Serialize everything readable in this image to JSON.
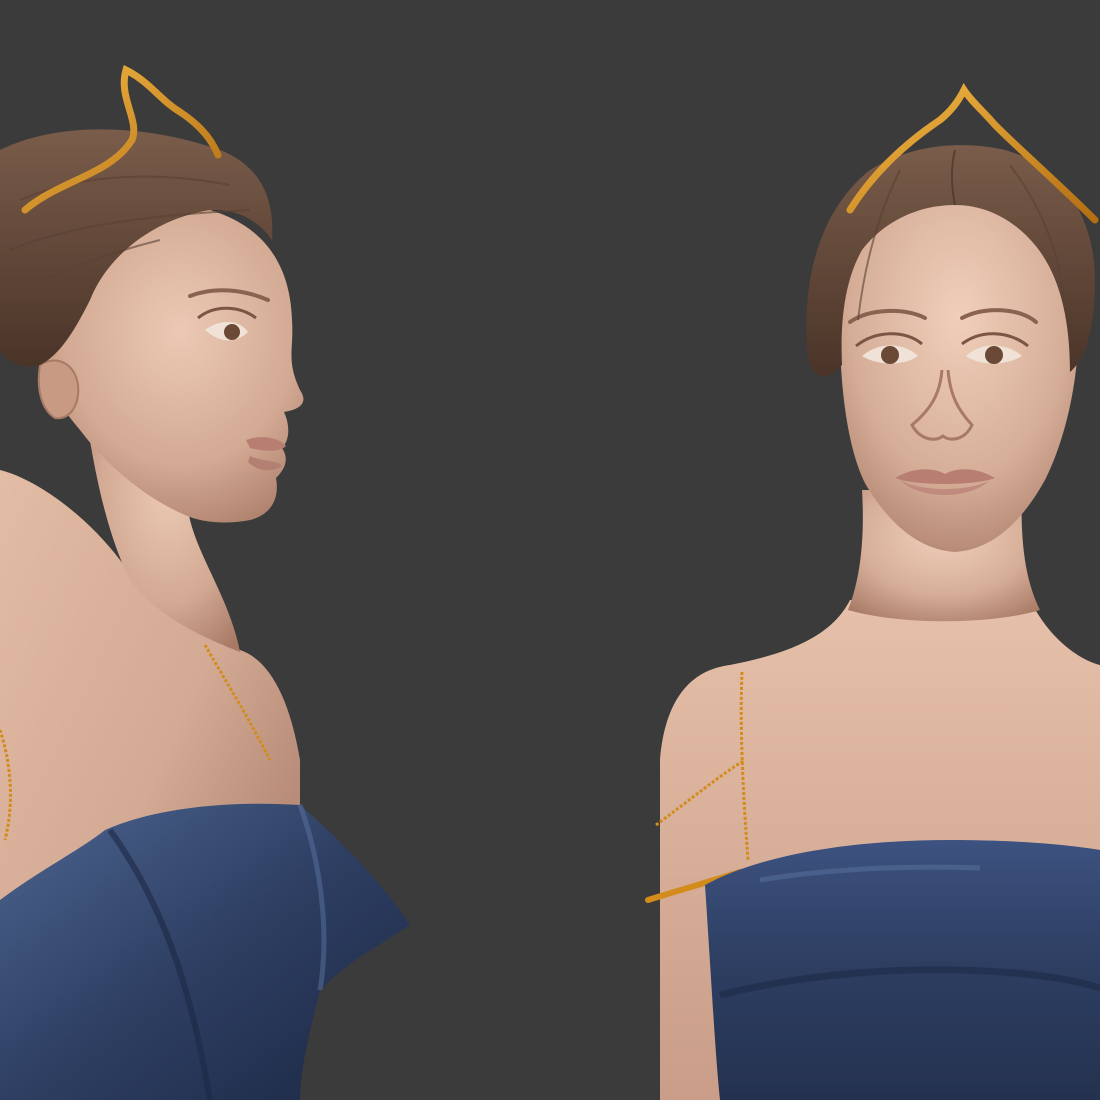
{
  "scene": {
    "background": "#3b3b3c",
    "colors": {
      "skin": "#d3aa94",
      "skin_shadow": "#a87a66",
      "skin_light": "#ecc9b4",
      "hair": "#6b4f3f",
      "hair_dark": "#4a3428",
      "gold": "#d38b1c",
      "gold_light": "#f2b845",
      "dress": "#2e3f63",
      "dress_light": "#4d6590",
      "dress_dark": "#1c2844",
      "lips": "#b97e72",
      "iris": "#6a4a36"
    },
    "figures": [
      {
        "view": "profile",
        "accessories": [
          "tiara",
          "arm-chain"
        ]
      },
      {
        "view": "front",
        "accessories": [
          "tiara",
          "arm-chain",
          "arm-band"
        ]
      }
    ]
  }
}
